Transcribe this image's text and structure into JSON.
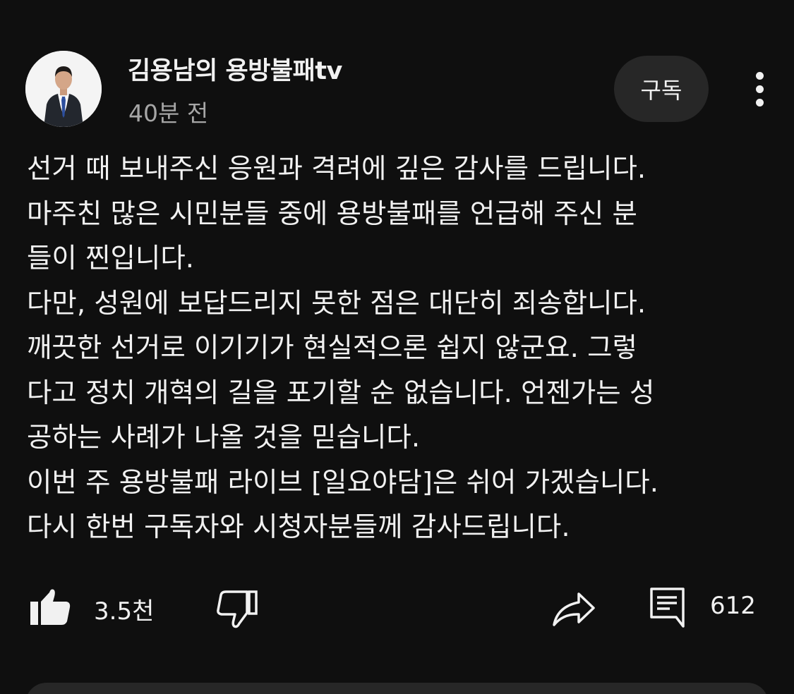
{
  "channel": {
    "name": "김용남의 용방불패tv",
    "time": "40분 전",
    "subscribe_label": "구독",
    "avatar_icon": "channel-avatar-photo",
    "more_icon": "more-vertical-icon"
  },
  "post": {
    "lines": [
      "선거 때 보내주신 응원과 격려에 깊은 감사를 드립니다.",
      "마주친 많은 시민분들 중에 용방불패를 언급해 주신 분",
      "들이 찐입니다.",
      "다만, 성원에 보답드리지 못한 점은 대단히 죄송합니다.",
      "깨끗한 선거로 이기기가 현실적으론 쉽지 않군요. 그렇",
      "다고 정치 개혁의 길을 포기할 순 없습니다. 언젠가는 성",
      "공하는 사례가 나올 것을 믿습니다.",
      "이번 주 용방불패 라이브 [일요야담]은 쉬어 가겠습니다.",
      "다시 한번 구독자와 시청자분들께 감사드립니다."
    ]
  },
  "actions": {
    "like_count": "3.5천",
    "comment_count": "612",
    "like_icon": "thumbs-up-filled-icon",
    "dislike_icon": "thumbs-down-icon",
    "share_icon": "share-arrow-icon",
    "comment_icon": "comment-icon"
  },
  "colors": {
    "background": "#0f0f0f",
    "text": "#f1f1f1",
    "secondary_text": "#a6a6a6",
    "button_bg": "#272727"
  }
}
